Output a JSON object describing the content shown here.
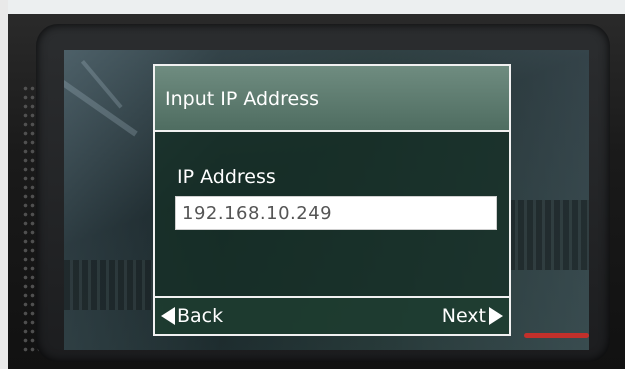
{
  "dialog": {
    "title": "Input IP Address",
    "field_label": "IP Address",
    "ip_value": "192.168.10.249"
  },
  "footer": {
    "back_label": "Back",
    "next_label": "Next"
  },
  "icons": {
    "back": "triangle-left-icon",
    "next": "triangle-right-icon"
  },
  "colors": {
    "dialog_header": "#5f7d71",
    "dialog_body": "#16302a",
    "border": "#f1f1f1",
    "input_bg": "#ffffff"
  }
}
